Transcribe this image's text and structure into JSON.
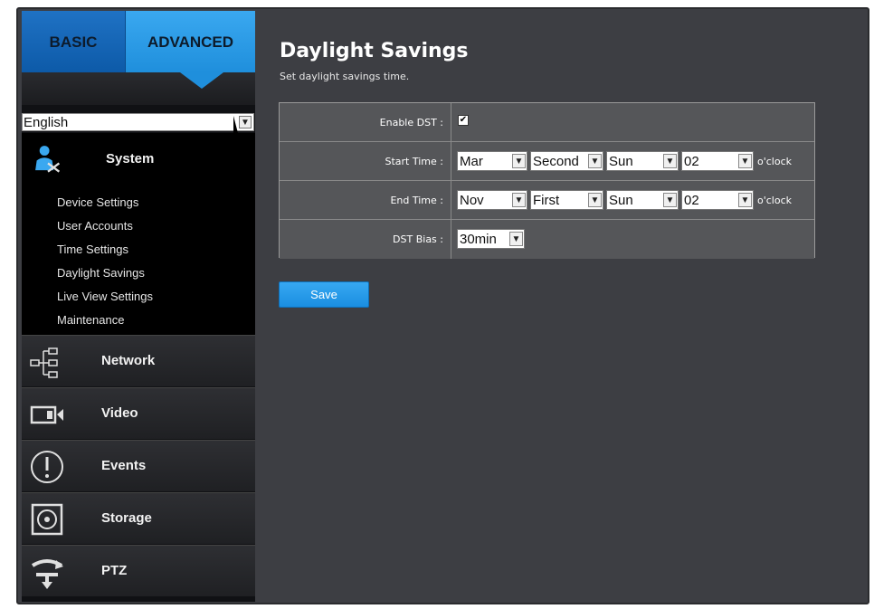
{
  "tabs": {
    "basic": "BASIC",
    "advanced": "ADVANCED"
  },
  "language": {
    "selected": "English"
  },
  "nav": {
    "system": "System",
    "system_items": [
      "Device Settings",
      "User Accounts",
      "Time Settings",
      "Daylight Savings",
      "Live View Settings",
      "Maintenance"
    ],
    "network": "Network",
    "video": "Video",
    "events": "Events",
    "storage": "Storage",
    "ptz": "PTZ"
  },
  "page": {
    "title": "Daylight Savings",
    "subtitle": "Set daylight savings time."
  },
  "form": {
    "enable_label": "Enable DST :",
    "enable_checked": true,
    "start_label": "Start Time :",
    "start": {
      "month": "Mar",
      "week": "Second",
      "day": "Sun",
      "hour": "02"
    },
    "end_label": "End Time :",
    "end": {
      "month": "Nov",
      "week": "First",
      "day": "Sun",
      "hour": "02"
    },
    "oclock": "o'clock",
    "bias_label": "DST Bias :",
    "bias": "30min"
  },
  "buttons": {
    "save": "Save"
  },
  "colors": {
    "accent": "#1f8fdc",
    "panel": "#3d3e43",
    "sidebar": "#101114"
  }
}
